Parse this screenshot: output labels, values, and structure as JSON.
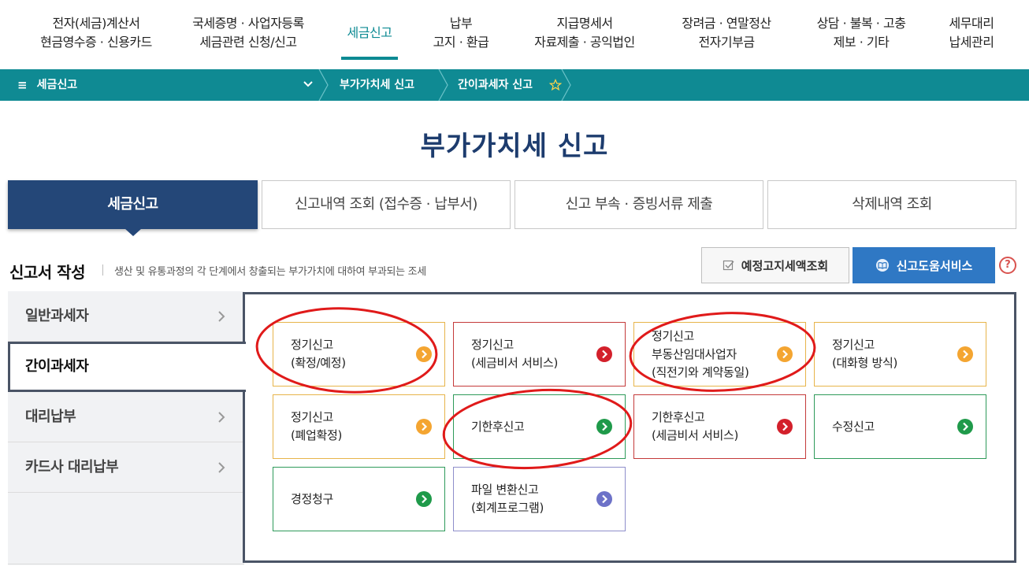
{
  "topnav": {
    "items": [
      {
        "line1": "전자(세금)계산서",
        "line2": "현금영수증 · 신용카드"
      },
      {
        "line1": "국세증명 · 사업자등록",
        "line2": "세금관련 신청/신고"
      },
      {
        "line1": "세금신고",
        "line2": ""
      },
      {
        "line1": "납부",
        "line2": "고지 · 환급"
      },
      {
        "line1": "지급명세서",
        "line2": "자료제출 · 공익법인"
      },
      {
        "line1": "장려금 · 연말정산",
        "line2": "전자기부금"
      },
      {
        "line1": "상담 · 불복 · 고충",
        "line2": "제보 · 기타"
      },
      {
        "line1": "세무대리",
        "line2": "납세관리"
      }
    ],
    "active_color": "#0c8a93"
  },
  "breadcrumb": {
    "menu_label": "세금신고",
    "level1": "부가가치세 신고",
    "level2": "간이과세자 신고"
  },
  "page_title": "부가가치세 신고",
  "tabs": [
    {
      "label": "세금신고"
    },
    {
      "label": "신고내역 조회 (접수증 · 납부서)"
    },
    {
      "label": "신고 부속 · 증빙서류 제출"
    },
    {
      "label": "삭제내역 조회"
    }
  ],
  "section": {
    "title": "신고서 작성",
    "description": "생산 및 유통과정의 각 단계에서 창출되는 부가가치에 대하여 부과되는 조세"
  },
  "actions": {
    "preview_label": "예정고지세액조회",
    "help_label": "신고도움서비스",
    "help_q": "?"
  },
  "sidebar": {
    "items": [
      {
        "label": "일반과세자"
      },
      {
        "label": "간이과세자"
      },
      {
        "label": "대리납부"
      },
      {
        "label": "카드사 대리납부"
      }
    ]
  },
  "cards": [
    {
      "line1": "정기신고",
      "line2": "(확정/예정)",
      "line3": "",
      "color": "or"
    },
    {
      "line1": "정기신고",
      "line2": "(세금비서 서비스)",
      "line3": "",
      "color": "rd"
    },
    {
      "line1": "정기신고",
      "line2": "부동산임대사업자",
      "line3": "(직전기와 계약동일)",
      "color": "or"
    },
    {
      "line1": "정기신고",
      "line2": "(대화형 방식)",
      "line3": "",
      "color": "or"
    },
    {
      "line1": "정기신고",
      "line2": "(폐업확정)",
      "line3": "",
      "color": "or"
    },
    {
      "line1": "기한후신고",
      "line2": "",
      "line3": "",
      "color": "gr"
    },
    {
      "line1": "기한후신고",
      "line2": "(세금비서 서비스)",
      "line3": "",
      "color": "rd"
    },
    {
      "line1": "수정신고",
      "line2": "",
      "line3": "",
      "color": "gr"
    },
    {
      "line1": "경정청구",
      "line2": "",
      "line3": "",
      "color": "gr"
    },
    {
      "line1": "파일 변환신고",
      "line2": "(회계프로그램)",
      "line3": "",
      "color": "pu"
    }
  ],
  "colors": {
    "header_teal": "#0f8a93",
    "active_tab": "#244778",
    "title_navy": "#1d3c6e",
    "help_blue": "#2f78c4",
    "annotation_red": "#e01a1a"
  }
}
